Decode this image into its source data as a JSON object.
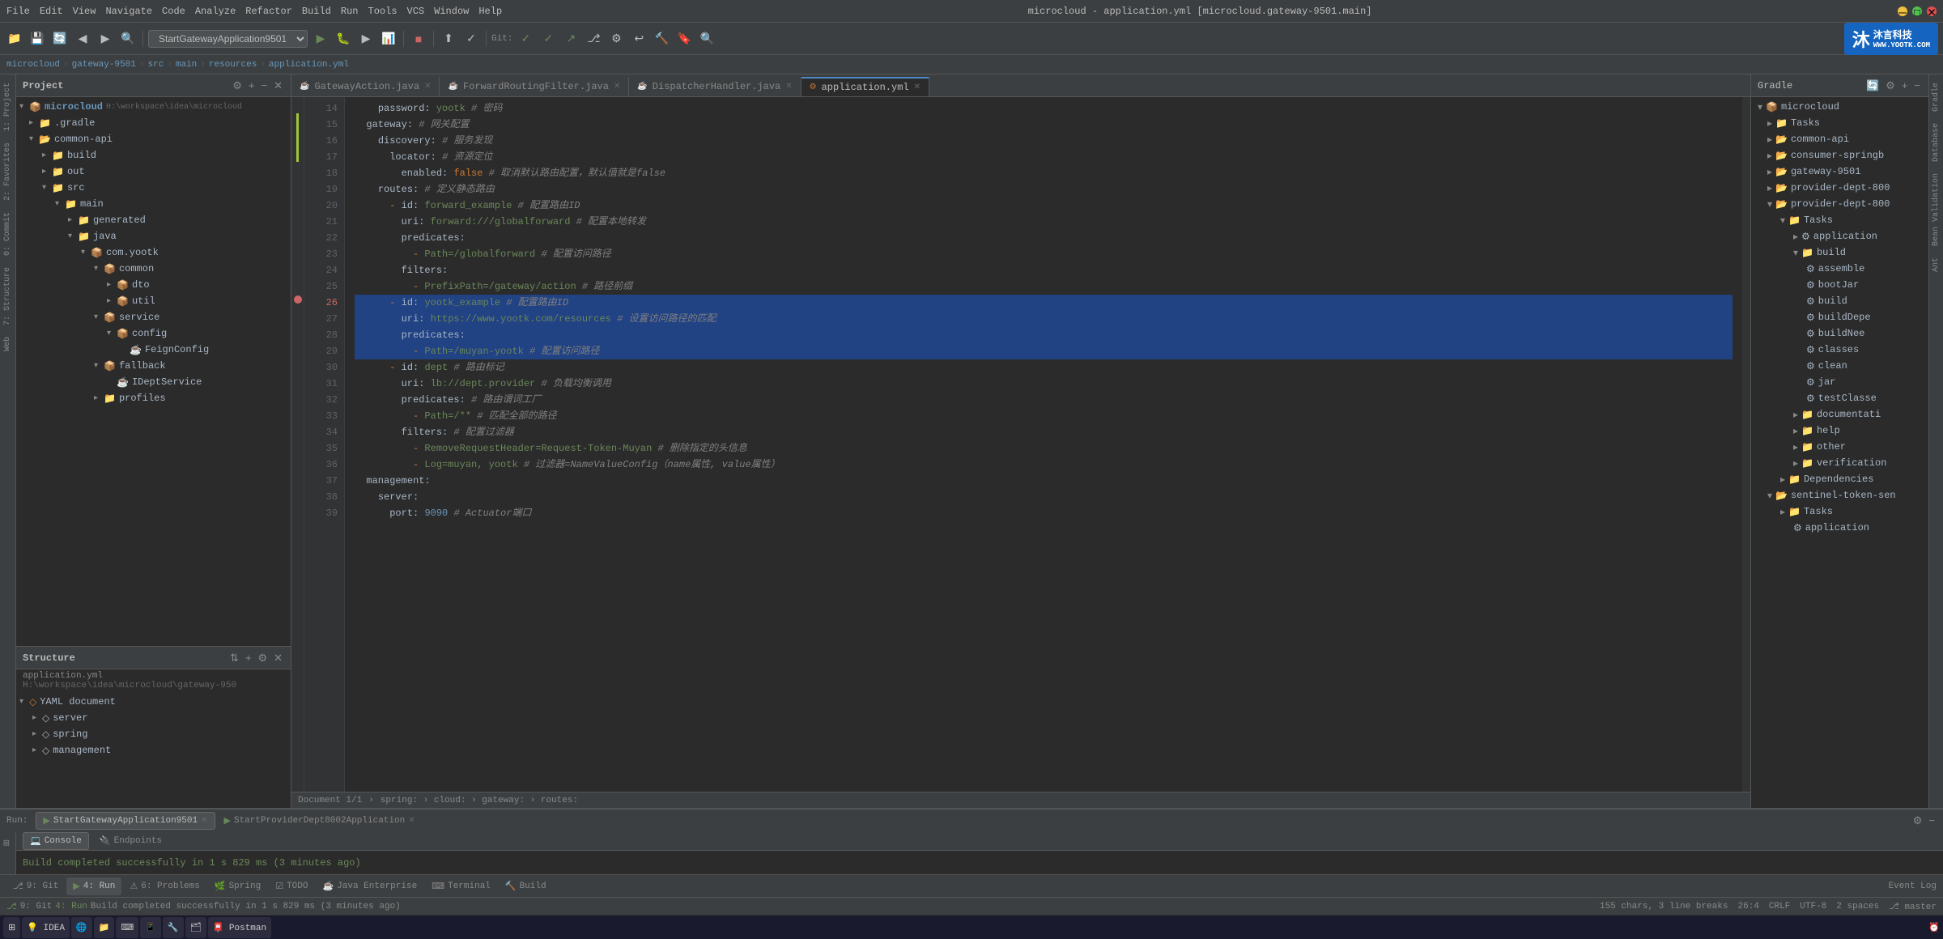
{
  "window": {
    "title": "microcloud - application.yml [microcloud.gateway-9501.main]",
    "controls": [
      "minimize",
      "maximize",
      "close"
    ]
  },
  "menu": {
    "items": [
      "File",
      "Edit",
      "View",
      "Navigate",
      "Code",
      "Analyze",
      "Refactor",
      "Build",
      "Run",
      "Tools",
      "VCS",
      "Window",
      "Help"
    ]
  },
  "toolbar": {
    "run_config": "StartGatewayApplication9501",
    "git_label": "Git:"
  },
  "breadcrumb": {
    "items": [
      "microcloud",
      "gateway-9501",
      "src",
      "main",
      "resources",
      "application.yml"
    ]
  },
  "editor_tabs": [
    {
      "label": "GatewayAction.java",
      "active": false,
      "modified": false
    },
    {
      "label": "ForwardRoutingFilter.java",
      "active": false,
      "modified": false
    },
    {
      "label": "DispatcherHandler.java",
      "active": false,
      "modified": false
    },
    {
      "label": "application.yml",
      "active": true,
      "modified": false
    }
  ],
  "code_lines": [
    {
      "num": 14,
      "content": "    password: yootk # 密码",
      "highlight": false
    },
    {
      "num": 15,
      "content": "  gateway: # 网关配置",
      "highlight": false
    },
    {
      "num": 16,
      "content": "    discovery: # 服务发现",
      "highlight": false
    },
    {
      "num": 17,
      "content": "      locator: # 资源定位",
      "highlight": false
    },
    {
      "num": 18,
      "content": "        enabled: false # 取消默认路由配置，默认值就是false",
      "highlight": false
    },
    {
      "num": 19,
      "content": "    routes: # 定义静态路由",
      "highlight": false
    },
    {
      "num": 20,
      "content": "      - id: forward_example # 配置路由ID",
      "highlight": false
    },
    {
      "num": 21,
      "content": "        uri: forward:///globalforward # 配置本地转发",
      "highlight": false
    },
    {
      "num": 22,
      "content": "        predicates:",
      "highlight": false
    },
    {
      "num": 23,
      "content": "          - Path=/globalforward # 配置访问路径",
      "highlight": false
    },
    {
      "num": 24,
      "content": "        filters:",
      "highlight": false
    },
    {
      "num": 25,
      "content": "          - PrefixPath=/gateway/action # 路径前缀",
      "highlight": false
    },
    {
      "num": 26,
      "content": "      - id: yootk_example # 配置路由ID",
      "highlight": true,
      "breakpoint": true
    },
    {
      "num": 27,
      "content": "        uri: https://www.yootk.com/resources # 设置访问路径的匹配",
      "highlight": true
    },
    {
      "num": 28,
      "content": "        predicates:",
      "highlight": true
    },
    {
      "num": 29,
      "content": "          - Path=/muyan-yootk # 配置访问路径",
      "highlight": true
    },
    {
      "num": 30,
      "content": "      - id: dept # 路由标记",
      "highlight": false
    },
    {
      "num": 31,
      "content": "        uri: lb://dept.provider # 负载均衡调用",
      "highlight": false
    },
    {
      "num": 32,
      "content": "        predicates: # 路由谓词工厂",
      "highlight": false
    },
    {
      "num": 33,
      "content": "          - Path=/** # 匹配全部的路径",
      "highlight": false
    },
    {
      "num": 34,
      "content": "        filters: # 配置过滤器",
      "highlight": false
    },
    {
      "num": 35,
      "content": "          - RemoveRequestHeader=Request-Token-Muyan # 删除指定的头信息",
      "highlight": false
    },
    {
      "num": 36,
      "content": "          - Log=muyan, yootk # 过滤器=NameValueConfig（name属性, value属性）",
      "highlight": false
    },
    {
      "num": 37,
      "content": "  management:",
      "highlight": false
    },
    {
      "num": 38,
      "content": "    server:",
      "highlight": false
    },
    {
      "num": 39,
      "content": "      port: 9090 # Actuator端口",
      "highlight": false
    }
  ],
  "project_tree": {
    "title": "Project",
    "items": [
      {
        "label": "microcloud",
        "path": "H:\\workspace\\idea\\microcloud",
        "type": "project",
        "indent": 0,
        "expanded": true
      },
      {
        "label": ".gradle",
        "type": "folder",
        "indent": 1,
        "expanded": false
      },
      {
        "label": "common-api",
        "type": "module",
        "indent": 1,
        "expanded": true
      },
      {
        "label": "build",
        "type": "folder",
        "indent": 2,
        "expanded": false
      },
      {
        "label": "out",
        "type": "folder",
        "indent": 2,
        "expanded": false
      },
      {
        "label": "src",
        "type": "folder",
        "indent": 2,
        "expanded": true
      },
      {
        "label": "main",
        "type": "folder",
        "indent": 3,
        "expanded": true
      },
      {
        "label": "generated",
        "type": "folder",
        "indent": 4,
        "expanded": false
      },
      {
        "label": "java",
        "type": "folder",
        "indent": 4,
        "expanded": true
      },
      {
        "label": "com.yootk",
        "type": "package",
        "indent": 5,
        "expanded": true
      },
      {
        "label": "common",
        "type": "package",
        "indent": 6,
        "expanded": true
      },
      {
        "label": "dto",
        "type": "package",
        "indent": 7,
        "expanded": false
      },
      {
        "label": "util",
        "type": "package",
        "indent": 7,
        "expanded": false
      },
      {
        "label": "service",
        "type": "package",
        "indent": 6,
        "expanded": true
      },
      {
        "label": "config",
        "type": "package",
        "indent": 7,
        "expanded": true
      },
      {
        "label": "FeignConfig",
        "type": "java",
        "indent": 8,
        "expanded": false
      },
      {
        "label": "fallback",
        "type": "package",
        "indent": 6,
        "expanded": true
      },
      {
        "label": "IDeptService",
        "type": "java",
        "indent": 7,
        "expanded": false
      },
      {
        "label": "profiles",
        "type": "folder",
        "indent": 6,
        "expanded": false
      }
    ]
  },
  "structure_panel": {
    "title": "Structure",
    "file": "application.yml",
    "path": "H:\\workspace\\idea\\microcloud\\gateway-950",
    "items": [
      {
        "label": "YAML document",
        "type": "yaml",
        "indent": 0,
        "expanded": true
      },
      {
        "label": "server",
        "type": "yaml",
        "indent": 1,
        "expanded": false
      },
      {
        "label": "spring",
        "type": "yaml",
        "indent": 1,
        "expanded": false
      },
      {
        "label": "management",
        "type": "yaml",
        "indent": 1,
        "expanded": false
      }
    ]
  },
  "gradle_panel": {
    "title": "Gradle",
    "items": [
      {
        "label": "microcloud",
        "type": "root",
        "indent": 0,
        "expanded": true
      },
      {
        "label": "Tasks",
        "type": "folder",
        "indent": 1,
        "expanded": false
      },
      {
        "label": "common-api",
        "type": "module",
        "indent": 1,
        "expanded": false
      },
      {
        "label": "consumer-springb",
        "type": "module",
        "indent": 1,
        "expanded": false
      },
      {
        "label": "gateway-9501",
        "type": "module",
        "indent": 1,
        "expanded": false
      },
      {
        "label": "provider-dept-800",
        "type": "module",
        "indent": 1,
        "expanded": false
      },
      {
        "label": "provider-dept-800",
        "type": "module",
        "indent": 1,
        "expanded": true
      },
      {
        "label": "Tasks",
        "type": "folder",
        "indent": 2,
        "expanded": true
      },
      {
        "label": "application",
        "type": "task",
        "indent": 3,
        "expanded": false
      },
      {
        "label": "build",
        "type": "folder",
        "indent": 3,
        "expanded": true
      },
      {
        "label": "assemble",
        "type": "task",
        "indent": 4,
        "expanded": false
      },
      {
        "label": "bootJar",
        "type": "task",
        "indent": 4,
        "expanded": false
      },
      {
        "label": "build",
        "type": "task",
        "indent": 4,
        "expanded": false
      },
      {
        "label": "buildDepe",
        "type": "task",
        "indent": 4,
        "expanded": false
      },
      {
        "label": "buildNee",
        "type": "task",
        "indent": 4,
        "expanded": false
      },
      {
        "label": "classes",
        "type": "task",
        "indent": 4,
        "expanded": false
      },
      {
        "label": "clean",
        "type": "task",
        "indent": 4,
        "expanded": false
      },
      {
        "label": "jar",
        "type": "task",
        "indent": 4,
        "expanded": false
      },
      {
        "label": "testClasse",
        "type": "task",
        "indent": 4,
        "expanded": false
      },
      {
        "label": "documentati",
        "type": "folder",
        "indent": 3,
        "expanded": false
      },
      {
        "label": "help",
        "type": "folder",
        "indent": 3,
        "expanded": false
      },
      {
        "label": "other",
        "type": "folder",
        "indent": 3,
        "expanded": false
      },
      {
        "label": "verification",
        "type": "folder",
        "indent": 3,
        "expanded": false
      },
      {
        "label": "Dependencies",
        "type": "folder",
        "indent": 2,
        "expanded": false
      },
      {
        "label": "sentinel-token-sen",
        "type": "module",
        "indent": 1,
        "expanded": true
      },
      {
        "label": "Tasks",
        "type": "folder",
        "indent": 2,
        "expanded": false
      },
      {
        "label": "application",
        "type": "task",
        "indent": 3,
        "expanded": false
      }
    ]
  },
  "bottom_panel": {
    "run_label": "Run:",
    "tabs": [
      {
        "label": "StartGatewayApplication9501",
        "active": true
      },
      {
        "label": "StartProviderDept8002Application",
        "active": false
      }
    ],
    "console_tabs": [
      {
        "label": "Console",
        "active": true
      },
      {
        "label": "Endpoints",
        "active": false
      }
    ]
  },
  "tool_tabs": [
    {
      "label": "9: Git",
      "active": false
    },
    {
      "label": "4: Run",
      "active": true
    },
    {
      "label": "6: Problems",
      "active": false
    },
    {
      "label": "Spring",
      "active": false
    },
    {
      "label": "TODO",
      "active": false
    },
    {
      "label": "Java Enterprise",
      "active": false
    },
    {
      "label": "Terminal",
      "active": false
    },
    {
      "label": "Build",
      "active": false
    }
  ],
  "status_bar": {
    "build_msg": "Build completed successfully in 1 s 829 ms (3 minutes ago)",
    "chars": "155 chars, 3 line breaks",
    "position": "26:4",
    "line_ending": "CRLF",
    "encoding": "UTF-8",
    "indent": "2 spaces",
    "branch": "master",
    "event_log": "Event Log"
  },
  "doc_nav": {
    "text": "Document 1/1",
    "path": "spring: › cloud: › gateway: › routes:"
  },
  "sidebar_left_tabs": [
    "1: Project",
    "2: Favorites",
    "0: Commit",
    "7: Structure"
  ],
  "sidebar_right_tabs": [
    "Gradle",
    "Database",
    "Bean Validation",
    "Ant"
  ],
  "logo": {
    "name": "沐言科技",
    "url": "WWW.YOOTK.COM"
  }
}
